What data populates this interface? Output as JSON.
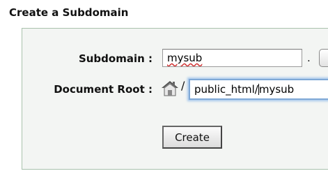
{
  "heading": "Create a Subdomain",
  "form": {
    "subdomain_label": "Subdomain :",
    "subdomain_value": "mysub",
    "separator": ".",
    "docroot_label": "Document Root :",
    "docroot_icon": "home-icon",
    "docroot_prefix": "/",
    "docroot_value_before_caret": "public_html/",
    "docroot_value_after_caret": "mysub",
    "create_label": "Create"
  },
  "colors": {
    "panel_border": "#a9c2ad",
    "focus_ring": "#7fa8d6"
  }
}
